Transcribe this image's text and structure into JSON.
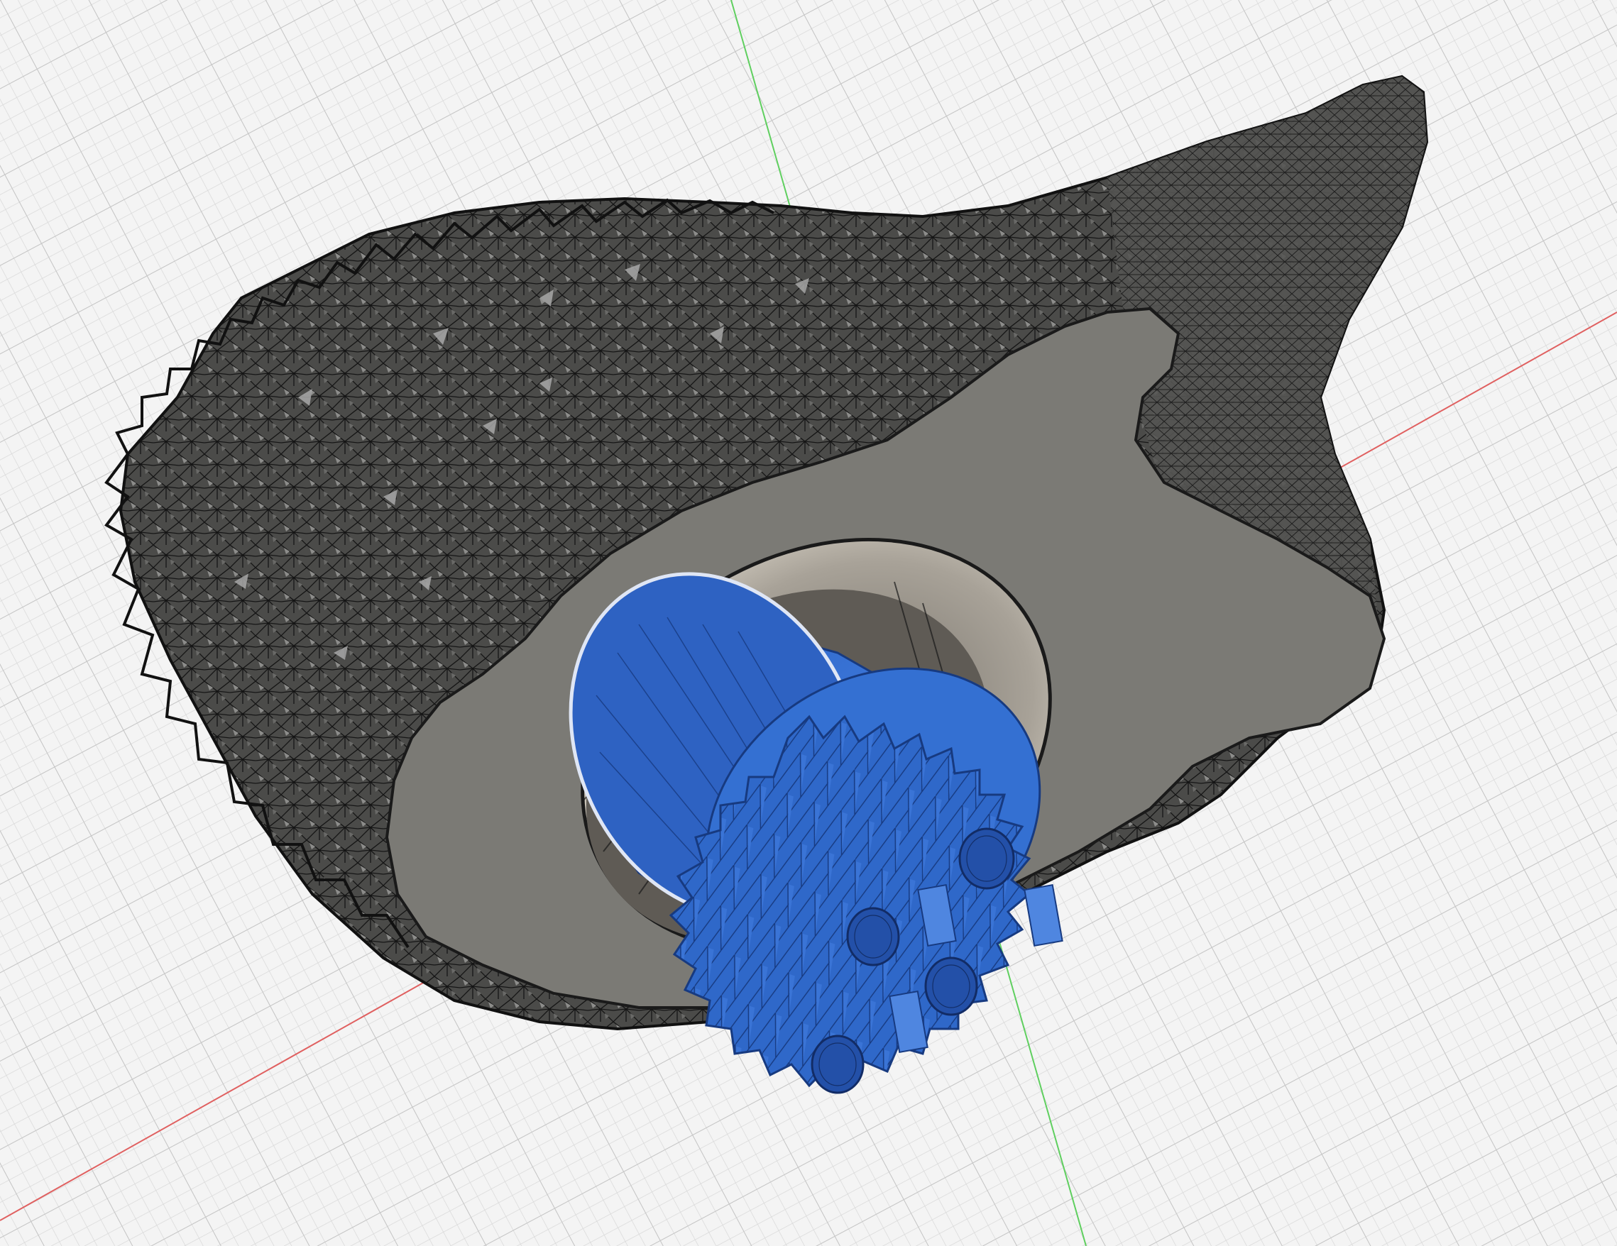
{
  "viewport": {
    "background": "#f4f4f4",
    "grid_minor_color": "#d9d9d9",
    "grid_major_color": "#c6c6c6",
    "x_axis_color": "#e06060",
    "y_axis_color": "#5fcf5f"
  },
  "scene": {
    "shell": {
      "mesh_fill": "#4b4b49",
      "mesh_line": "#111111",
      "highlight": "#a8a8a8"
    },
    "section_face": {
      "fill": "#7b7a75",
      "edge": "#1a1a1a"
    },
    "bore": {
      "fill": "#c9c3b7",
      "shade": "#8f8a80"
    },
    "knob": {
      "fill": "#2f68c9",
      "light": "#4f86e0",
      "dark": "#1f4ea3",
      "line": "#173a80"
    }
  }
}
